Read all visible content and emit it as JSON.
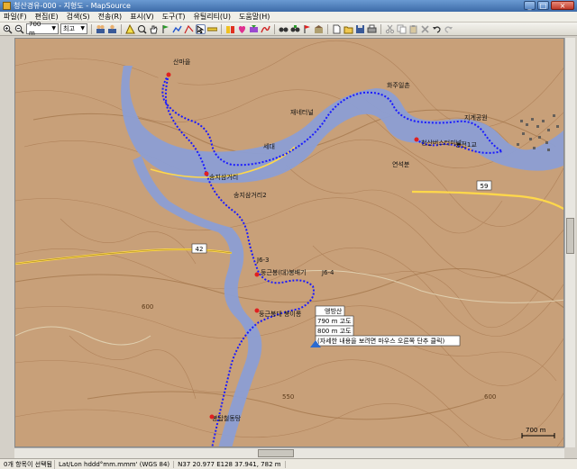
{
  "window": {
    "title": "청산경유-000 - 지형도 - MapSource",
    "buttons": [
      "_",
      "□",
      "×"
    ]
  },
  "menu": {
    "items": [
      "파일(F)",
      "편집(E)",
      "검색(S)",
      "전송(R)",
      "표시(V)",
      "도구(T)",
      "유틸리티(U)",
      "도움말(H)"
    ]
  },
  "toolbar": {
    "zoom_value": "700 m",
    "detail_value": "최고"
  },
  "map": {
    "labels": {
      "a": "산마을",
      "b": "청산버스터미널",
      "c": "용전1교",
      "d": "화주일촌",
      "e": "지계공원",
      "f": "재네터널",
      "g": "세대",
      "h": "송지삼거리",
      "i": "송지삼거리2",
      "j": "둥근봉(대)봉배기",
      "k": "둥근봉대 봉이롱",
      "l": "J6-3",
      "m": "J6-4",
      "n": "봉탑철동탕",
      "o": "연석분",
      "p": "42",
      "q": "59",
      "r": "550",
      "s": "600",
      "t": "600"
    },
    "tooltip": {
      "title": "앵방산",
      "line1": "790 m 고도",
      "line2": "800 m 고도",
      "line3": "(자세한 내용을 보려면 마우스 오른쪽 단추 클릭)"
    },
    "scale": "700 m",
    "colors": {
      "terrain": "#c8a079",
      "water": "#8c9ed4",
      "track": "#1a1aff",
      "road_yellow": "#ffd84a",
      "contour": "#a87850"
    }
  },
  "status": {
    "selection": "0개 항목이 선택됨",
    "format": "Lat/Lon hddd°mm.mmm' (WGS 84)",
    "coords": "N37 20.977 E128 37.941, 782 m"
  }
}
